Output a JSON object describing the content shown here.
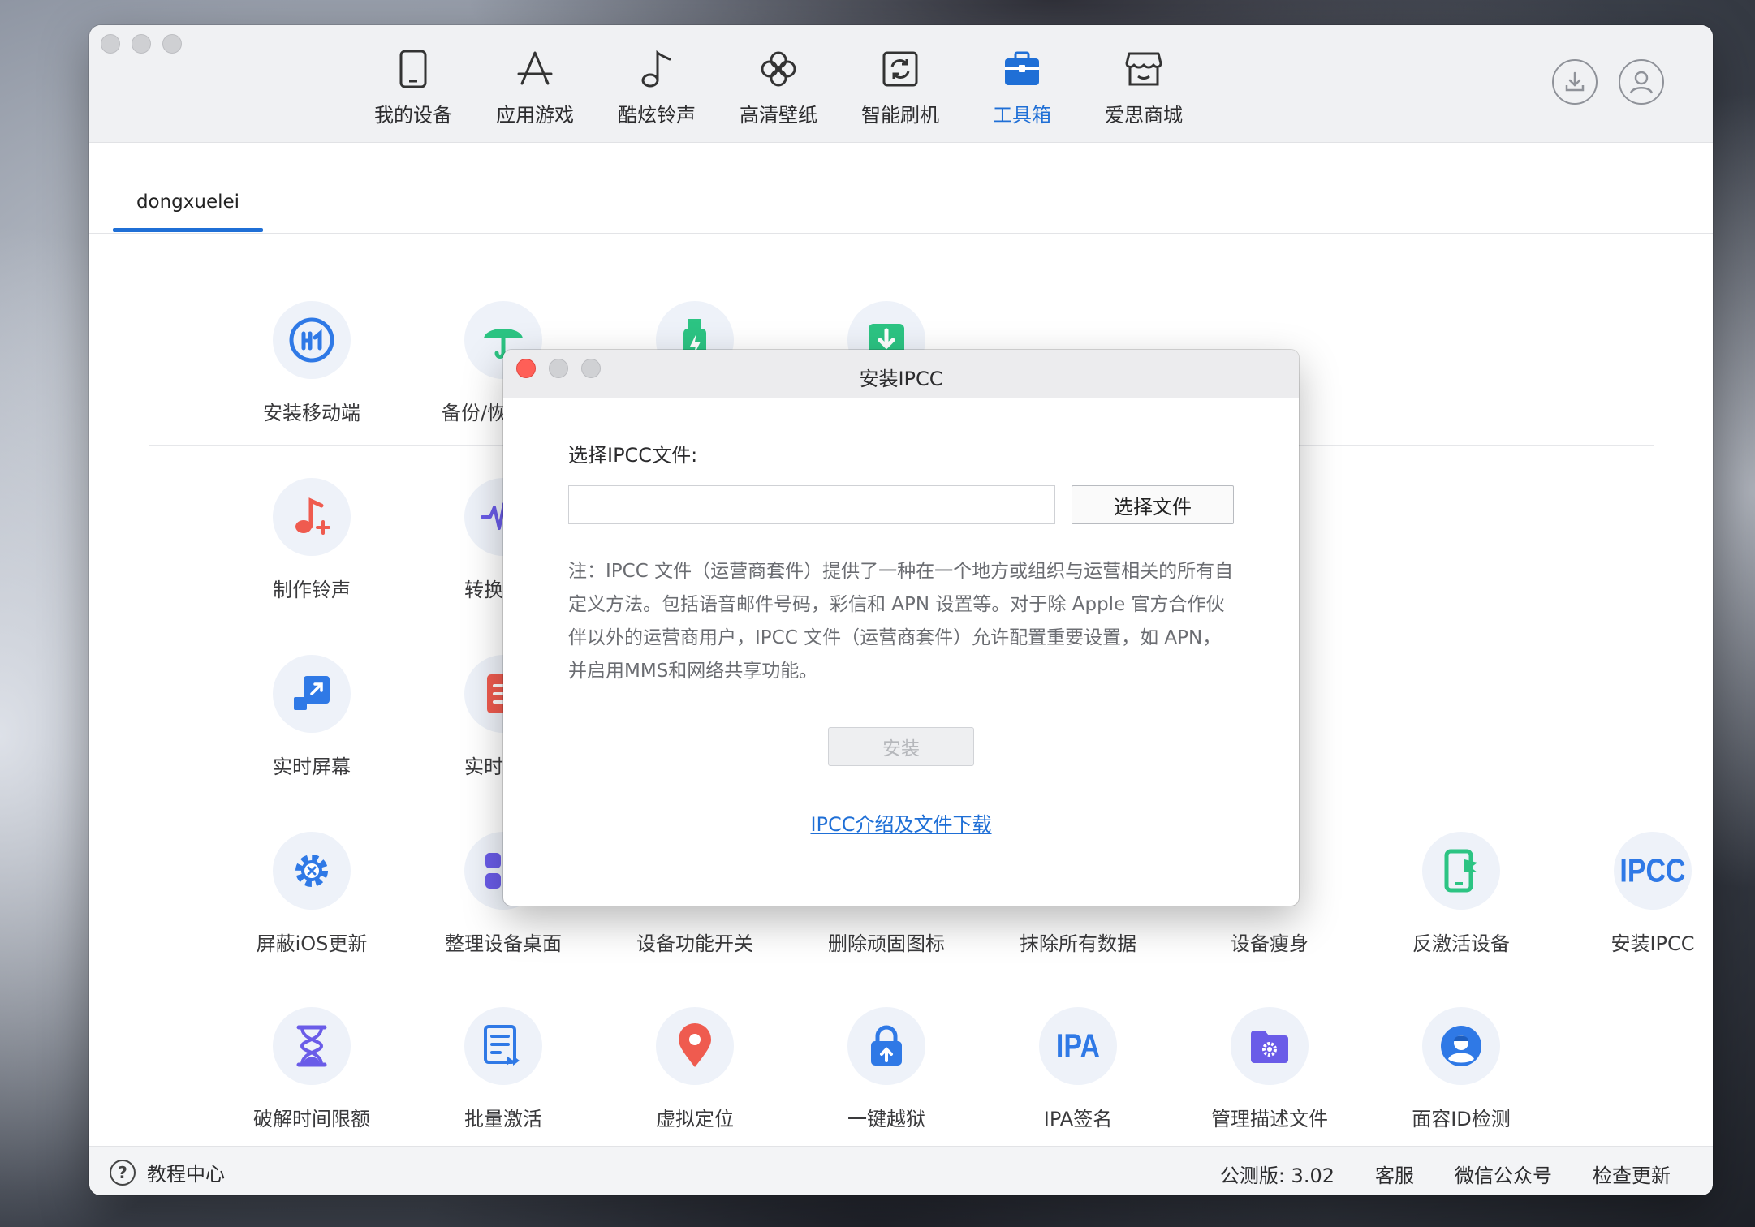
{
  "nav": {
    "items": [
      {
        "label": "我的设备",
        "icon": "phone-icon"
      },
      {
        "label": "应用游戏",
        "icon": "app-store-icon"
      },
      {
        "label": "酷炫铃声",
        "icon": "music-note-icon"
      },
      {
        "label": "高清壁纸",
        "icon": "flower-icon"
      },
      {
        "label": "智能刷机",
        "icon": "refresh-box-icon"
      },
      {
        "label": "工具箱",
        "icon": "toolbox-icon"
      },
      {
        "label": "爱思商城",
        "icon": "store-icon"
      }
    ],
    "active": "工具箱"
  },
  "tabs": {
    "device": "dongxuelei"
  },
  "tools": {
    "row1": [
      "安装移动端",
      "备份/恢复数据"
    ],
    "row2": [
      "制作铃声",
      "转换音频"
    ],
    "row3": [
      "实时屏幕",
      "实时日志"
    ],
    "row4": [
      "屏蔽iOS更新",
      "整理设备桌面",
      "设备功能开关",
      "删除顽固图标",
      "抹除所有数据",
      "设备瘦身",
      "反激活设备",
      "安装IPCC"
    ],
    "row5": [
      "破解时间限额",
      "批量激活",
      "虚拟定位",
      "一键越狱",
      "IPA签名",
      "管理描述文件",
      "面容ID检测"
    ]
  },
  "status": {
    "help": "教程中心",
    "version": "公测版: 3.02",
    "service": "客服",
    "wechat": "微信公众号",
    "update": "检查更新"
  },
  "dialog": {
    "title": "安装IPCC",
    "field_label": "选择IPCC文件:",
    "file_value": "",
    "choose_button": "选择文件",
    "note": "注：IPCC 文件（运营商套件）提供了一种在一个地方或组织与运营相关的所有自定义方法。包括语音邮件号码，彩信和 APN 设置等。对于除 Apple 官方合作伙伴以外的运营商用户，IPCC 文件（运营商套件）允许配置重要设置，如 APN，并启用MMS和网络共享功能。",
    "install_button": "安装",
    "link": "IPCC介绍及文件下载"
  },
  "colors": {
    "accent": "#1f6fd6",
    "green": "#2cc483",
    "red": "#ef5b4f",
    "purple": "#6a5ce8",
    "blue": "#2f79e6"
  }
}
